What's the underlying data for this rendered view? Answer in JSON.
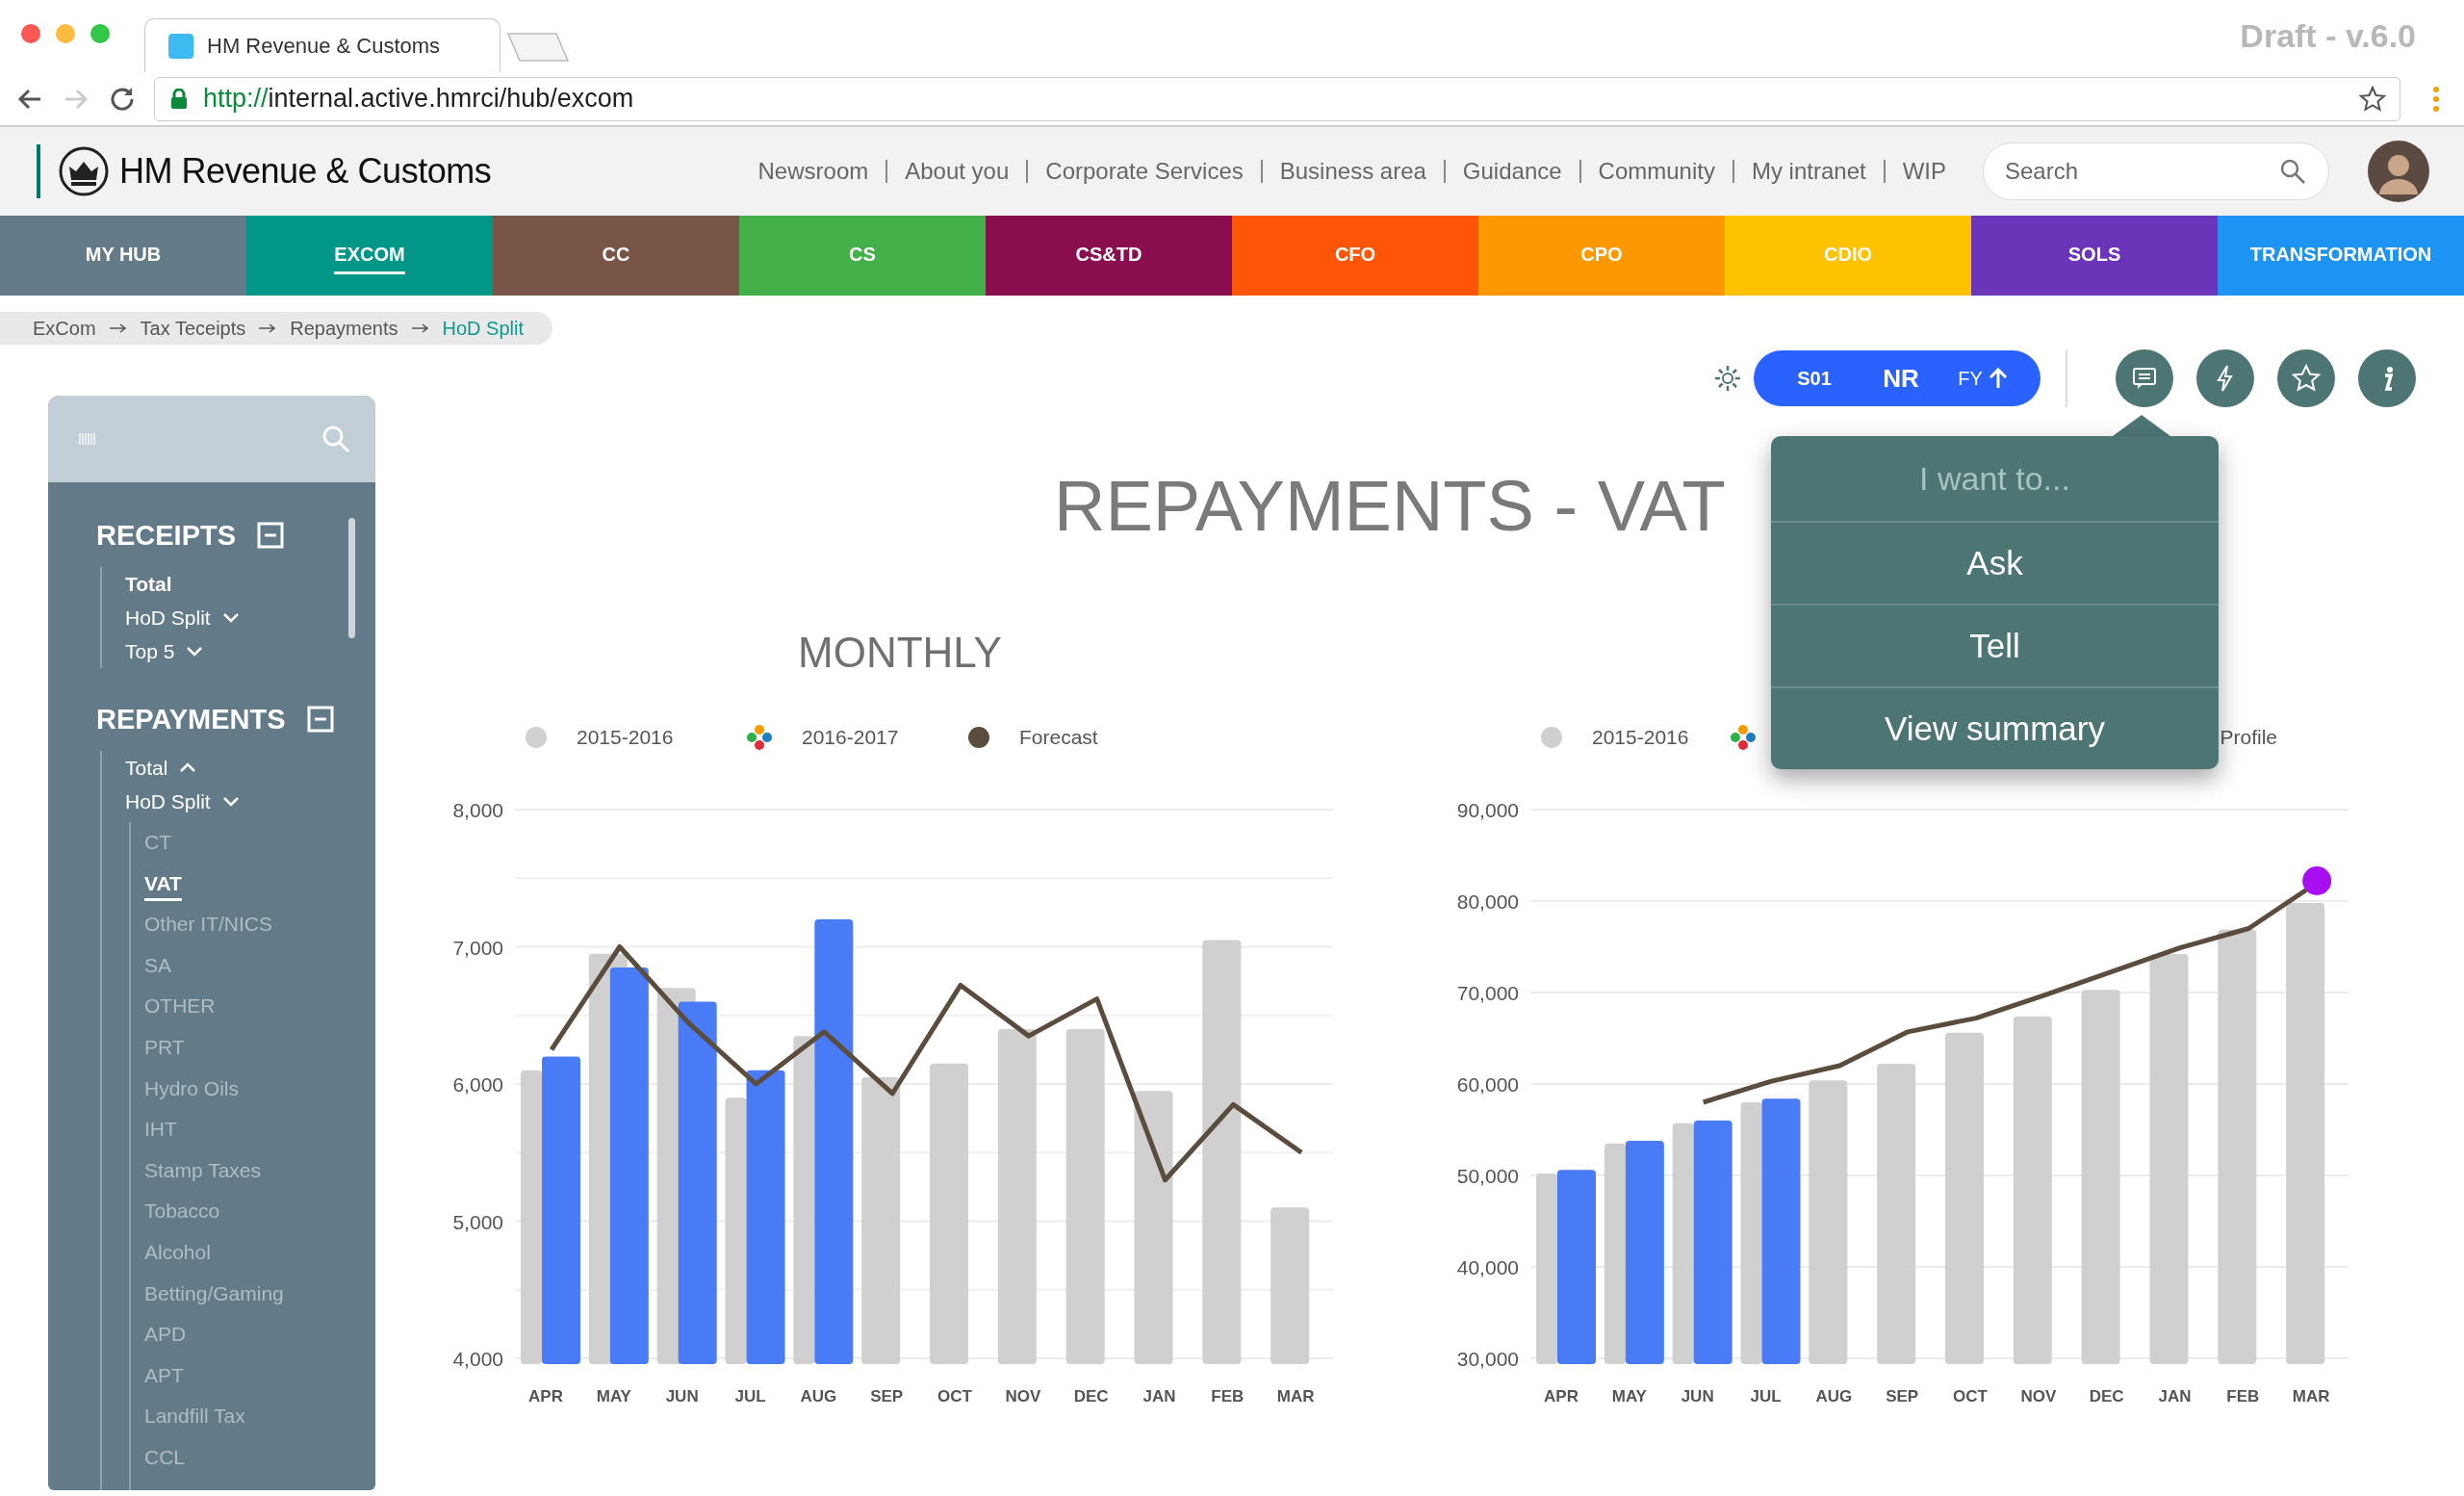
{
  "browser": {
    "tab_title": "HM Revenue & Customs",
    "draft_label": "Draft - v.6.0",
    "url_scheme": "http://",
    "url_path": "internal.active.hmrci/hub/excom"
  },
  "header": {
    "brand": "HM Revenue & Customs",
    "links": [
      "Newsroom",
      "About you",
      "Corporate Services",
      "Business area",
      "Guidance",
      "Community",
      "My intranet",
      "WIP"
    ],
    "search": {
      "placeholder": "Search"
    }
  },
  "nav_tabs": [
    {
      "label": "MY HUB",
      "color": "#637a88",
      "selected": false
    },
    {
      "label": "EXCOM",
      "color": "#009688",
      "selected": true
    },
    {
      "label": "CC",
      "color": "#795548",
      "selected": false
    },
    {
      "label": "CS",
      "color": "#43b04a",
      "selected": false
    },
    {
      "label": "CS&TD",
      "color": "#880e4f",
      "selected": false
    },
    {
      "label": "CFO",
      "color": "#fe5508",
      "selected": false
    },
    {
      "label": "CPO",
      "color": "#fe9800",
      "selected": false
    },
    {
      "label": "CDIO",
      "color": "#fec200",
      "selected": false
    },
    {
      "label": "SOLS",
      "color": "#6a35b9",
      "selected": false
    },
    {
      "label": "TRANSFORMATION",
      "color": "#1d93f3",
      "selected": false
    }
  ],
  "breadcrumb": [
    {
      "label": "ExCom",
      "selected": false
    },
    {
      "label": "Tax Teceipts",
      "selected": false
    },
    {
      "label": "Repayments",
      "selected": false
    },
    {
      "label": "HoD Split",
      "selected": true
    }
  ],
  "sidebar": {
    "sections": [
      {
        "title": "RECEIPTS",
        "items": [
          {
            "label": "Total",
            "selected": true
          },
          {
            "label": "HoD Split",
            "selected": false,
            "expanded": false
          },
          {
            "label": "Top 5",
            "selected": false,
            "expanded": false
          }
        ]
      },
      {
        "title": "REPAYMENTS",
        "items": [
          {
            "label": "Total",
            "selected": false,
            "expanded": true
          },
          {
            "label": "HoD Split",
            "selected": false,
            "expanded": false,
            "children": [
              {
                "label": "CT",
                "selected": false
              },
              {
                "label": "VAT",
                "selected": true
              },
              {
                "label": "Other IT/NICS",
                "selected": false
              },
              {
                "label": "SA",
                "selected": false
              },
              {
                "label": "OTHER",
                "selected": false
              },
              {
                "label": "PRT",
                "selected": false
              },
              {
                "label": "Hydro Oils",
                "selected": false
              },
              {
                "label": "IHT",
                "selected": false
              },
              {
                "label": "Stamp Taxes",
                "selected": false
              },
              {
                "label": "Tobacco",
                "selected": false
              },
              {
                "label": "Alcohol",
                "selected": false
              },
              {
                "label": "Betting/Gaming",
                "selected": false
              },
              {
                "label": "APD",
                "selected": false
              },
              {
                "label": "APT",
                "selected": false
              },
              {
                "label": "Landfill Tax",
                "selected": false
              },
              {
                "label": "CCL",
                "selected": false
              }
            ]
          }
        ]
      }
    ]
  },
  "toolbar": {
    "segments": [
      {
        "label": "S01",
        "kind": "small"
      },
      {
        "label": "NR",
        "kind": "large"
      },
      {
        "label": "FY",
        "kind": "sort"
      }
    ],
    "actions": [
      {
        "kind": "chat"
      },
      {
        "kind": "bolt"
      },
      {
        "kind": "star"
      },
      {
        "kind": "info"
      }
    ]
  },
  "page_title": "REPAYMENTS - VAT",
  "menu": {
    "header": "I want to...",
    "items": [
      "Ask",
      "Tell",
      "View summary"
    ]
  },
  "charts": [
    {
      "title": "MONTHLY",
      "chart_data": {
        "type": "bar",
        "stacked": false,
        "grid": true,
        "categories": [
          "APR",
          "MAY",
          "JUN",
          "JUL",
          "AUG",
          "SEP",
          "OCT",
          "NOV",
          "DEC",
          "JAN",
          "FEB",
          "MAR"
        ],
        "ylim": [
          4000,
          8000
        ],
        "yticks": [
          {
            "value": 4000,
            "label": "4,000"
          },
          {
            "value": 5000,
            "label": "5,000"
          },
          {
            "value": 6000,
            "label": "6,000"
          },
          {
            "value": 7000,
            "label": "7,000"
          },
          {
            "value": 8000,
            "label": "8,000"
          }
        ],
        "series": [
          {
            "name": "2015-2016",
            "type": "bar",
            "color": "#d0d0d0",
            "values": [
              6100,
              6950,
              6700,
              5900,
              6350,
              6050,
              6150,
              6400,
              6400,
              5950,
              7050,
              5100
            ]
          },
          {
            "name": "2016-2017",
            "type": "bar",
            "color": "#4a7bf7",
            "values": [
              6200,
              6850,
              6600,
              6100,
              7200,
              null,
              null,
              null,
              null,
              null,
              null,
              null
            ]
          },
          {
            "name": "Forecast",
            "type": "line",
            "color": "#5a4d3e",
            "values": [
              6250,
              7000,
              6450,
              6000,
              6380,
              5930,
              6720,
              6350,
              6620,
              5300,
              5850,
              5500
            ]
          }
        ]
      }
    },
    {
      "end_marker": {
        "color": "#a80ff0"
      },
      "chart_data": {
        "type": "bar",
        "stacked": false,
        "grid": true,
        "categories": [
          "APR",
          "MAY",
          "JUN",
          "JUL",
          "AUG",
          "SEP",
          "OCT",
          "NOV",
          "DEC",
          "JAN",
          "FEB",
          "MAR"
        ],
        "ylim": [
          30000,
          90000
        ],
        "yticks": [
          {
            "value": 30000,
            "label": "30,000"
          },
          {
            "value": 40000,
            "label": "40,000"
          },
          {
            "value": 50000,
            "label": "50,000"
          },
          {
            "value": 60000,
            "label": "60,000"
          },
          {
            "value": 70000,
            "label": "70,000"
          },
          {
            "value": 80000,
            "label": "80,000"
          },
          {
            "value": 90000,
            "label": "90,000"
          }
        ],
        "series": [
          {
            "name": "2015-2016",
            "type": "bar",
            "color": "#d0d0d0",
            "values": [
              50200,
              53500,
              55700,
              58000,
              60400,
              62200,
              65600,
              67400,
              70300,
              74200,
              76900,
              79800
            ]
          },
          {
            "type": "bar",
            "color": "#4a7bf7",
            "values": [
              50600,
              53800,
              56000,
              58400,
              null,
              null,
              null,
              null,
              null,
              null,
              null,
              null
            ]
          },
          {
            "name": "Profile",
            "type": "line",
            "color": "#5a4d3e",
            "values": [
              null,
              null,
              58000,
              60300,
              62000,
              65700,
              67200,
              69700,
              72300,
              74900,
              77000,
              82000
            ]
          }
        ]
      }
    }
  ]
}
